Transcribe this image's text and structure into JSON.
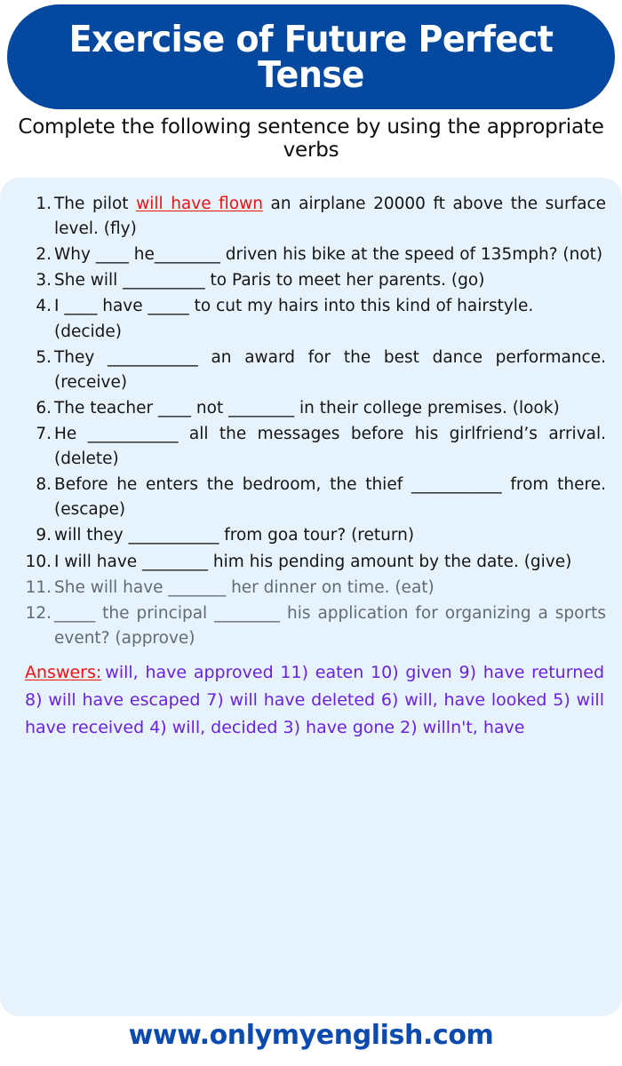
{
  "header": {
    "title": "Exercise of Future Perfect Tense",
    "background_color": "#04499f",
    "text_color": "#ffffff"
  },
  "subtitle": "Complete the following sentence by using the appropriate verbs",
  "panel": {
    "background_color": "#e7f3fc"
  },
  "exercise": {
    "items": [
      {
        "number": "1.",
        "pre": "The pilot ",
        "filled_answer": "will have flown",
        "post": " an airplane 20000 ft above the surface level. (fly)",
        "dim": false,
        "justify": true
      },
      {
        "number": "2.",
        "pre": "Why ____ he________ driven his bike at the speed of 135mph? (not)",
        "filled_answer": "",
        "post": "",
        "dim": false,
        "justify": true
      },
      {
        "number": "3.",
        "pre": "She will __________ to Paris to meet her parents. (go)",
        "filled_answer": "",
        "post": "",
        "dim": false,
        "justify": false
      },
      {
        "number": "4.",
        "pre": "I ____ have _____ to cut my hairs into this kind of hairstyle. (decide)",
        "filled_answer": "",
        "post": "",
        "dim": false,
        "justify": false
      },
      {
        "number": "5.",
        "pre": "They ___________ an award for the best dance performance. (receive)",
        "filled_answer": "",
        "post": "",
        "dim": false,
        "justify": true
      },
      {
        "number": "6.",
        "pre": "The teacher ____ not ________ in their college premises. (look)",
        "filled_answer": "",
        "post": "",
        "dim": false,
        "justify": true
      },
      {
        "number": "7.",
        "pre": "He ___________ all the messages before his girlfriend’s arrival. (delete)",
        "filled_answer": "",
        "post": "",
        "dim": false,
        "justify": true
      },
      {
        "number": "8.",
        "pre": "Before he enters the bedroom, the thief ___________ from there. (escape)",
        "filled_answer": "",
        "post": "",
        "dim": false,
        "justify": true
      },
      {
        "number": "9.",
        "pre": "will they ___________ from goa tour? (return)",
        "filled_answer": "",
        "post": "",
        "dim": false,
        "justify": false
      },
      {
        "number": "10.",
        "pre": "I will have ________ him his pending amount by the date. (give)",
        "filled_answer": "",
        "post": "",
        "dim": false,
        "justify": true
      },
      {
        "number": "11.",
        "pre": "She will have _______ her dinner on time. (eat)",
        "filled_answer": "",
        "post": "",
        "dim": true,
        "justify": false
      },
      {
        "number": "12.",
        "pre": "_____ the principal ________ his application for organizing a sports event? (approve)",
        "filled_answer": "",
        "post": "",
        "dim": true,
        "justify": true
      }
    ]
  },
  "answers": {
    "label": "Answers:",
    "text": "will, have approved 11) eaten 10) given 9) have returned 8) will have escaped 7) will have deleted 6) will, have looked 5) will have received 4) will, decided 3) have gone 2) willn't, have",
    "text_color": "#6a22e0",
    "label_color": "#ee1111"
  },
  "footer": {
    "url": "www.onlymyenglish.com",
    "color": "#0b4bb0"
  }
}
